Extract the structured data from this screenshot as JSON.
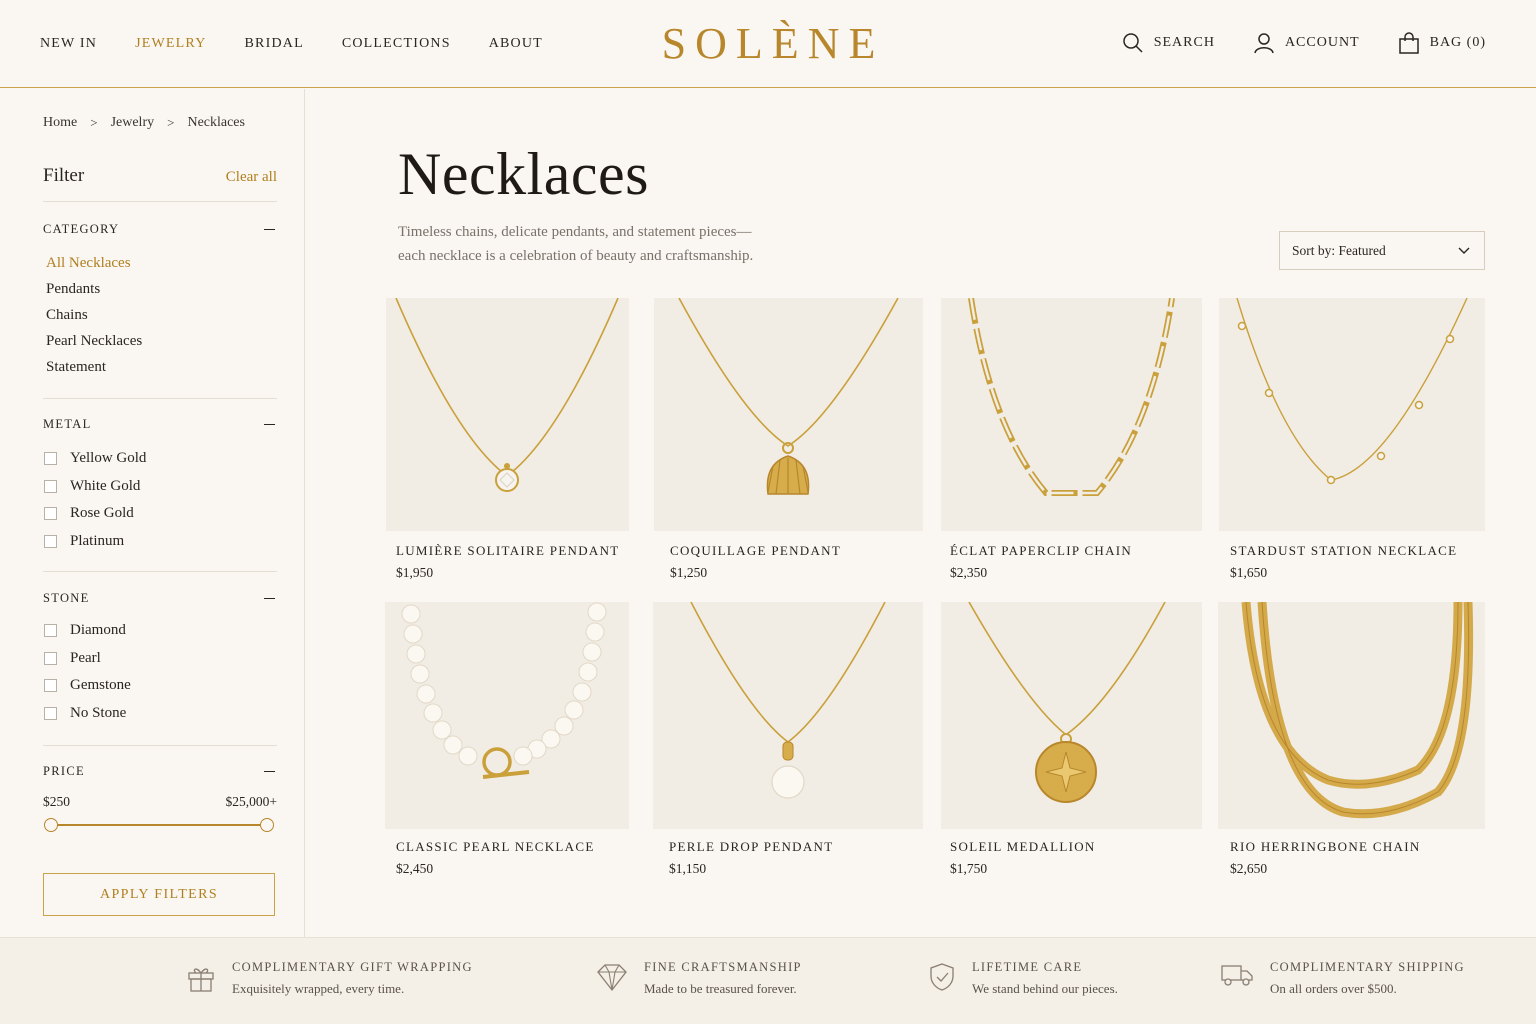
{
  "colors": {
    "accent": "#b8862b",
    "background": "#faf7f2",
    "text": "#2a2520",
    "image_bg": "#f1ece4"
  },
  "header": {
    "nav": [
      "NEW IN",
      "JEWELRY",
      "BRIDAL",
      "COLLECTIONS",
      "ABOUT"
    ],
    "active_nav": "JEWELRY",
    "logo": "SOLÈNE",
    "search_label": "SEARCH",
    "account_label": "ACCOUNT",
    "bag_label": "BAG (0)"
  },
  "breadcrumb": {
    "items": [
      "Home",
      "Jewelry",
      "Necklaces"
    ]
  },
  "filters": {
    "title": "Filter",
    "clear_label": "Clear all",
    "category": {
      "title": "CATEGORY",
      "items": [
        "All Necklaces",
        "Pendants",
        "Chains",
        "Pearl Necklaces",
        "Statement"
      ],
      "selected": "All Necklaces"
    },
    "metal": {
      "title": "METAL",
      "options": [
        "Yellow Gold",
        "White Gold",
        "Rose Gold",
        "Platinum"
      ]
    },
    "stone": {
      "title": "STONE",
      "options": [
        "Diamond",
        "Pearl",
        "Gemstone",
        "No Stone"
      ]
    },
    "price": {
      "title": "PRICE",
      "min_label": "$250",
      "max_label": "$25,000+",
      "range_fraction": [
        0,
        1
      ]
    },
    "apply_label": "APPLY FILTERS"
  },
  "main": {
    "title": "Necklaces",
    "description_line1": "Timeless chains, delicate pendants, and statement pieces—",
    "description_line2": "each necklace is a celebration of beauty and craftsmanship.",
    "sort_label": "Sort by: Featured"
  },
  "products": [
    {
      "name": "LUMIÈRE SOLITAIRE PENDANT",
      "price": "$1,950",
      "icon": "solitaire-diamond-pendant"
    },
    {
      "name": "COQUILLAGE PENDANT",
      "price": "$1,250",
      "icon": "shell-pendant"
    },
    {
      "name": "ÉCLAT PAPERCLIP CHAIN",
      "price": "$2,350",
      "icon": "paperclip-chain"
    },
    {
      "name": "STARDUST STATION NECKLACE",
      "price": "$1,650",
      "icon": "station-necklace"
    },
    {
      "name": "CLASSIC PEARL NECKLACE",
      "price": "$2,450",
      "icon": "pearl-necklace"
    },
    {
      "name": "PERLE DROP PENDANT",
      "price": "$1,150",
      "icon": "pearl-drop-pendant"
    },
    {
      "name": "SOLEIL MEDALLION",
      "price": "$1,750",
      "icon": "medallion-pendant"
    },
    {
      "name": "RIO HERRINGBONE CHAIN",
      "price": "$2,650",
      "icon": "herringbone-chain"
    }
  ],
  "footer": {
    "features": [
      {
        "title": "COMPLIMENTARY GIFT WRAPPING",
        "subtitle": "Exquisitely wrapped, every time.",
        "icon": "gift-icon"
      },
      {
        "title": "FINE CRAFTSMANSHIP",
        "subtitle": "Made to be treasured forever.",
        "icon": "diamond-icon"
      },
      {
        "title": "LIFETIME CARE",
        "subtitle": "We stand behind our pieces.",
        "icon": "shield-check-icon"
      },
      {
        "title": "COMPLIMENTARY SHIPPING",
        "subtitle": "On all orders over $500.",
        "icon": "truck-icon"
      }
    ]
  }
}
